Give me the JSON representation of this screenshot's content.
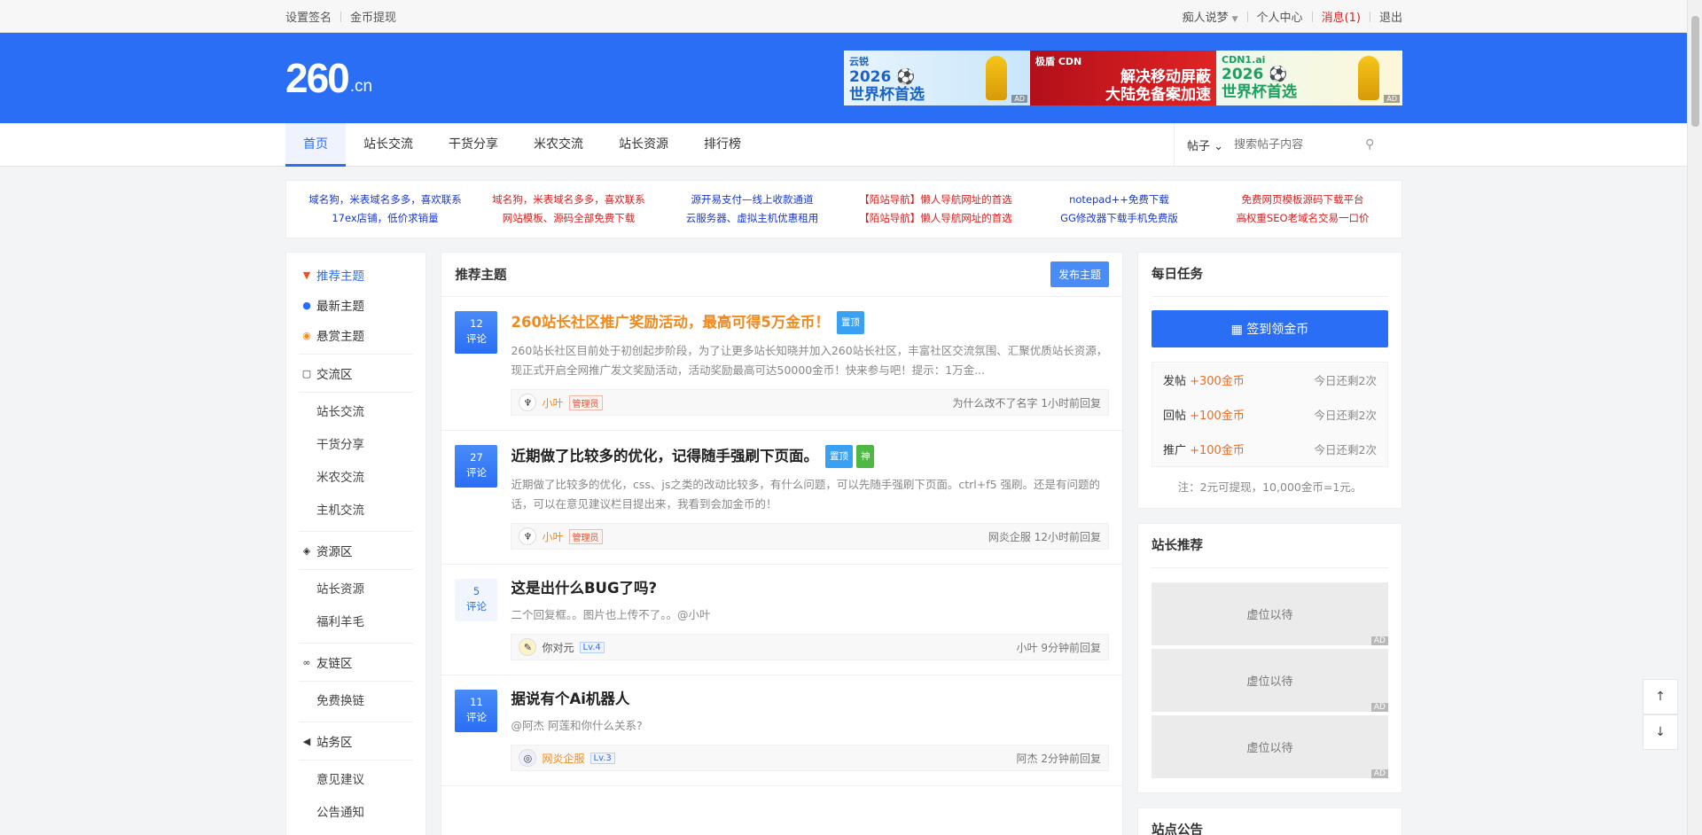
{
  "topbar": {
    "left": [
      "设置签名",
      "金币提现"
    ],
    "user": "痴人说梦",
    "right": [
      "个人中心",
      "消息(1)",
      "退出"
    ]
  },
  "header": {
    "logo": "260",
    "logo_suffix": ".cn",
    "ads": [
      {
        "brand": "云锐",
        "line1": "2026 ⚽",
        "line2": "世界杯首选",
        "tag": "AD"
      },
      {
        "brand": "极盾 CDN",
        "line1": "解决移动屏蔽",
        "line2": "大陆免备案加速",
        "tag": ""
      },
      {
        "brand": "CDN1.ai",
        "line1": "2026 ⚽",
        "line2": "世界杯首选",
        "tag": "AD"
      }
    ]
  },
  "nav": {
    "items": [
      "首页",
      "站长交流",
      "干货分享",
      "米农交流",
      "站长资源",
      "排行榜"
    ],
    "search_type": "帖子",
    "search_placeholder": "搜索帖子内容"
  },
  "links": [
    {
      "text": "域名狗，米表域名多多，喜欢联系",
      "color": "blue"
    },
    {
      "text": "域名狗，米表域名多多，喜欢联系",
      "color": "red"
    },
    {
      "text": "源开易支付—线上收款通道",
      "color": "blue"
    },
    {
      "text": "【陌站导航】懒人导航网址的首选",
      "color": "red"
    },
    {
      "text": "notepad++免费下载",
      "color": "blue"
    },
    {
      "text": "免费网页模板源码下载平台",
      "color": "red"
    },
    {
      "text": "17ex店铺，低价求销量",
      "color": "blue"
    },
    {
      "text": "网站模板、源码全部免费下载",
      "color": "red"
    },
    {
      "text": "云服务器、虚拟主机优惠租用",
      "color": "blue"
    },
    {
      "text": "【陌站导航】懒人导航网址的首选",
      "color": "red"
    },
    {
      "text": "GG修改器下载手机免费版",
      "color": "blue"
    },
    {
      "text": "高权重SEO老域名交易一口价",
      "color": "red"
    }
  ],
  "sidebar": {
    "top": [
      "推荐主题",
      "最新主题",
      "悬赏主题"
    ],
    "sections": [
      {
        "title": "交流区",
        "items": [
          "站长交流",
          "干货分享",
          "米农交流",
          "主机交流"
        ]
      },
      {
        "title": "资源区",
        "items": [
          "站长资源",
          "福利羊毛"
        ]
      },
      {
        "title": "友链区",
        "items": [
          "免费换链"
        ]
      },
      {
        "title": "站务区",
        "items": [
          "意见建议",
          "公告通知"
        ]
      }
    ]
  },
  "main": {
    "title": "推荐主题",
    "publish": "发布主题",
    "posts": [
      {
        "count": "12",
        "count_label": "评论",
        "title": "260站长社区推广奖励活动，最高可得5万金币！",
        "badges": [
          "置顶"
        ],
        "excerpt": "260站长社区目前处于初创起步阶段，为了让更多站长知晓并加入260站长社区，丰富社区交流氛围、汇聚优质站长资源，现正式开启全网推广发文奖励活动，活动奖励最高可达50000金币！快来参与吧！提示：1万金...",
        "user": "小叶",
        "role": "管理员",
        "reply": "为什么改不了名字 1小时前回复"
      },
      {
        "count": "27",
        "count_label": "评论",
        "title": "近期做了比较多的优化，记得随手强刷下页面。",
        "badges": [
          "置顶",
          "神"
        ],
        "excerpt": "近期做了比较多的优化，css、js之类的改动比较多，有什么问题，可以先随手强刷下页面。ctrl+f5 强刷。还是有问题的话，可以在意见建议栏目提出来，我看到会加金币的！",
        "user": "小叶",
        "role": "管理员",
        "reply": "网炎企服 12小时前回复"
      },
      {
        "count": "5",
        "count_label": "评论",
        "title": "这是出什么BUG了吗?",
        "badges": [],
        "excerpt": "二个回复框。。图片也上传不了。。@小叶",
        "user": "你对元",
        "role": "Lv.4",
        "reply": "小叶 9分钟前回复"
      },
      {
        "count": "11",
        "count_label": "评论",
        "title": "据说有个Ai机器人",
        "badges": [],
        "excerpt": "@阿杰 阿莲和你什么关系?",
        "user": "网炎企服",
        "role": "Lv.3",
        "reply": "阿杰 2分钟前回复"
      }
    ]
  },
  "daily": {
    "title": "每日任务",
    "sign": "签到领金币",
    "tasks": [
      {
        "name": "发帖",
        "reward": "+300金币",
        "remain": "今日还剩2次"
      },
      {
        "name": "回帖",
        "reward": "+100金币",
        "remain": "今日还剩2次"
      },
      {
        "name": "推广",
        "reward": "+100金币",
        "remain": "今日还剩2次"
      }
    ],
    "note": "注：2元可提现，10,000金币=1元。"
  },
  "recommend": {
    "title": "站长推荐",
    "slot": "虚位以待",
    "tag": "AD"
  },
  "notice": {
    "title": "站点公告"
  },
  "colors": {
    "brand": "#2a6ef5",
    "accent": "#f2891c",
    "red": "#e02020"
  }
}
